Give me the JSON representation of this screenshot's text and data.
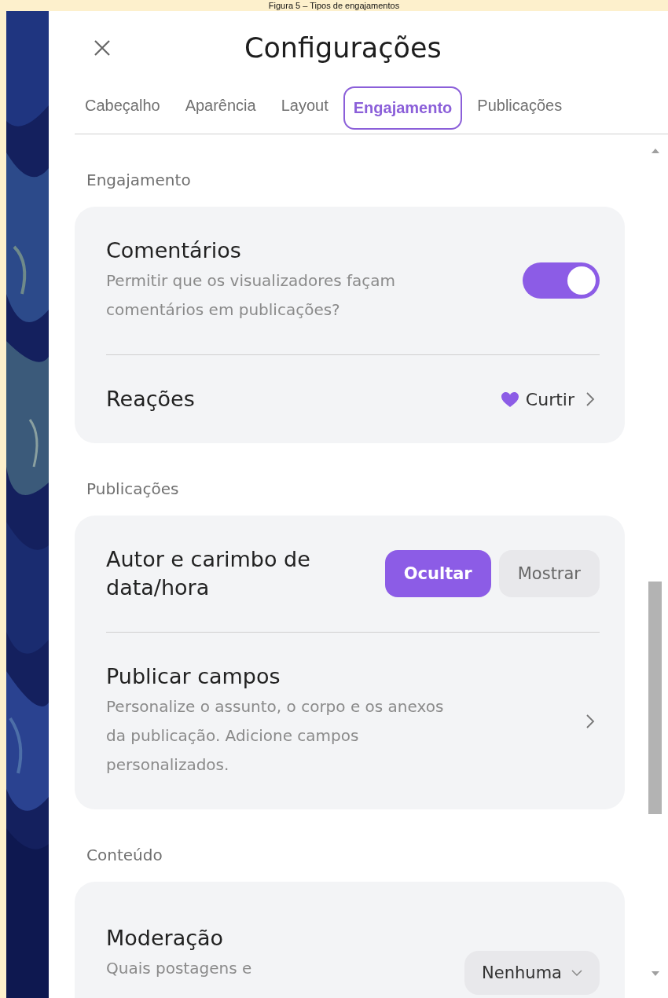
{
  "caption": "Figura 5 – Tipos de engajamentos",
  "dialog": {
    "title": "Configurações",
    "tabs": [
      {
        "label": "Cabeçalho",
        "selected": false
      },
      {
        "label": "Aparência",
        "selected": false
      },
      {
        "label": "Layout",
        "selected": false
      },
      {
        "label": "Engajamento",
        "selected": true
      },
      {
        "label": "Publicações",
        "selected": false
      }
    ],
    "sections": [
      {
        "heading": "Engajamento",
        "rows": [
          {
            "kind": "toggle",
            "title": "Comentários",
            "description": "Permitir que os visualizadores façam comentários em publicações?",
            "on": true
          },
          {
            "kind": "link",
            "title": "Reações",
            "value": "Curtir"
          }
        ]
      },
      {
        "heading": "Publicações",
        "rows": [
          {
            "kind": "segmented",
            "title": "Autor e carimbo de data/hora",
            "options": [
              {
                "label": "Ocultar",
                "selected": true
              },
              {
                "label": "Mostrar",
                "selected": false
              }
            ]
          },
          {
            "kind": "link",
            "title": "Publicar campos",
            "description": "Personalize o assunto, o corpo e os anexos da publicação. Adicione campos personalizados."
          }
        ]
      },
      {
        "heading": "Conteúdo",
        "rows": [
          {
            "kind": "dropdown",
            "title": "Moderação",
            "description": "Quais postagens e",
            "value": "Nenhuma"
          }
        ]
      }
    ]
  }
}
